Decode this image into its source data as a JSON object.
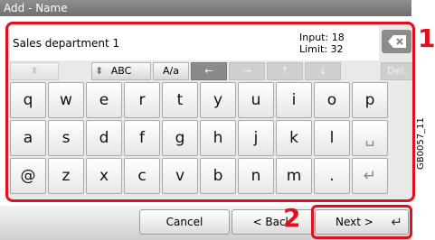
{
  "window": {
    "title": "Add - Name"
  },
  "input": {
    "text": "Sales department 1",
    "input_label": "Input:",
    "input_value": "18",
    "limit_label": "Limit:",
    "limit_value": "32"
  },
  "controls": {
    "mode_label": "ABC",
    "case_label": "A/a",
    "delete_label": "Del."
  },
  "keyboard": {
    "row1": [
      "q",
      "w",
      "e",
      "r",
      "t",
      "y",
      "u",
      "i",
      "o",
      "p"
    ],
    "row2": [
      "a",
      "s",
      "d",
      "f",
      "g",
      "h",
      "j",
      "k",
      "l"
    ],
    "row3": [
      "@",
      "z",
      "x",
      "c",
      "v",
      "b",
      "n",
      "m",
      "."
    ]
  },
  "footer": {
    "cancel": "Cancel",
    "back": "< Back",
    "next": "Next >"
  },
  "annotations": {
    "callout_1": "1",
    "callout_2": "2",
    "figure_code": "GB0057_11"
  },
  "colors": {
    "highlight": "#e0101e",
    "title_bar": "#7f7f7f",
    "key_dark": "#8a8a8a"
  }
}
